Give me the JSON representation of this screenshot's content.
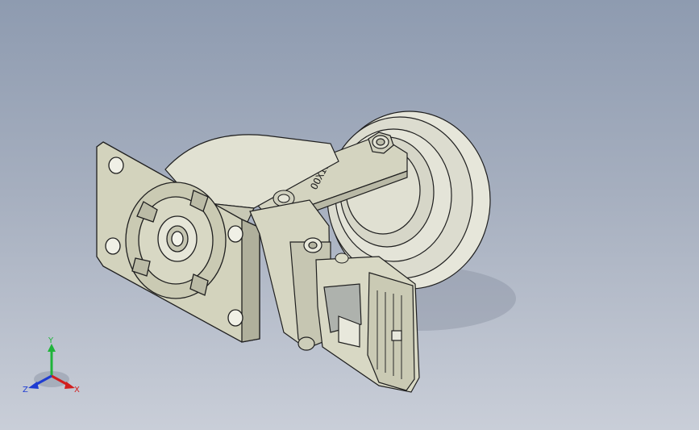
{
  "window": {
    "title": ""
  },
  "model": {
    "name": "",
    "engraving": "OOXIP",
    "part_colors": {
      "wheel": "#e3e3d6",
      "housing": "#d8d8c4",
      "plate": "#d2d2bc",
      "outline": "#1f1f1f",
      "shadow": "#6f7a8c"
    }
  },
  "triad": {
    "x_label": "X",
    "y_label": "Y",
    "z_label": "Z",
    "colors": {
      "x": "#d21e1e",
      "y": "#1fb43a",
      "z": "#1e3cd2"
    }
  }
}
